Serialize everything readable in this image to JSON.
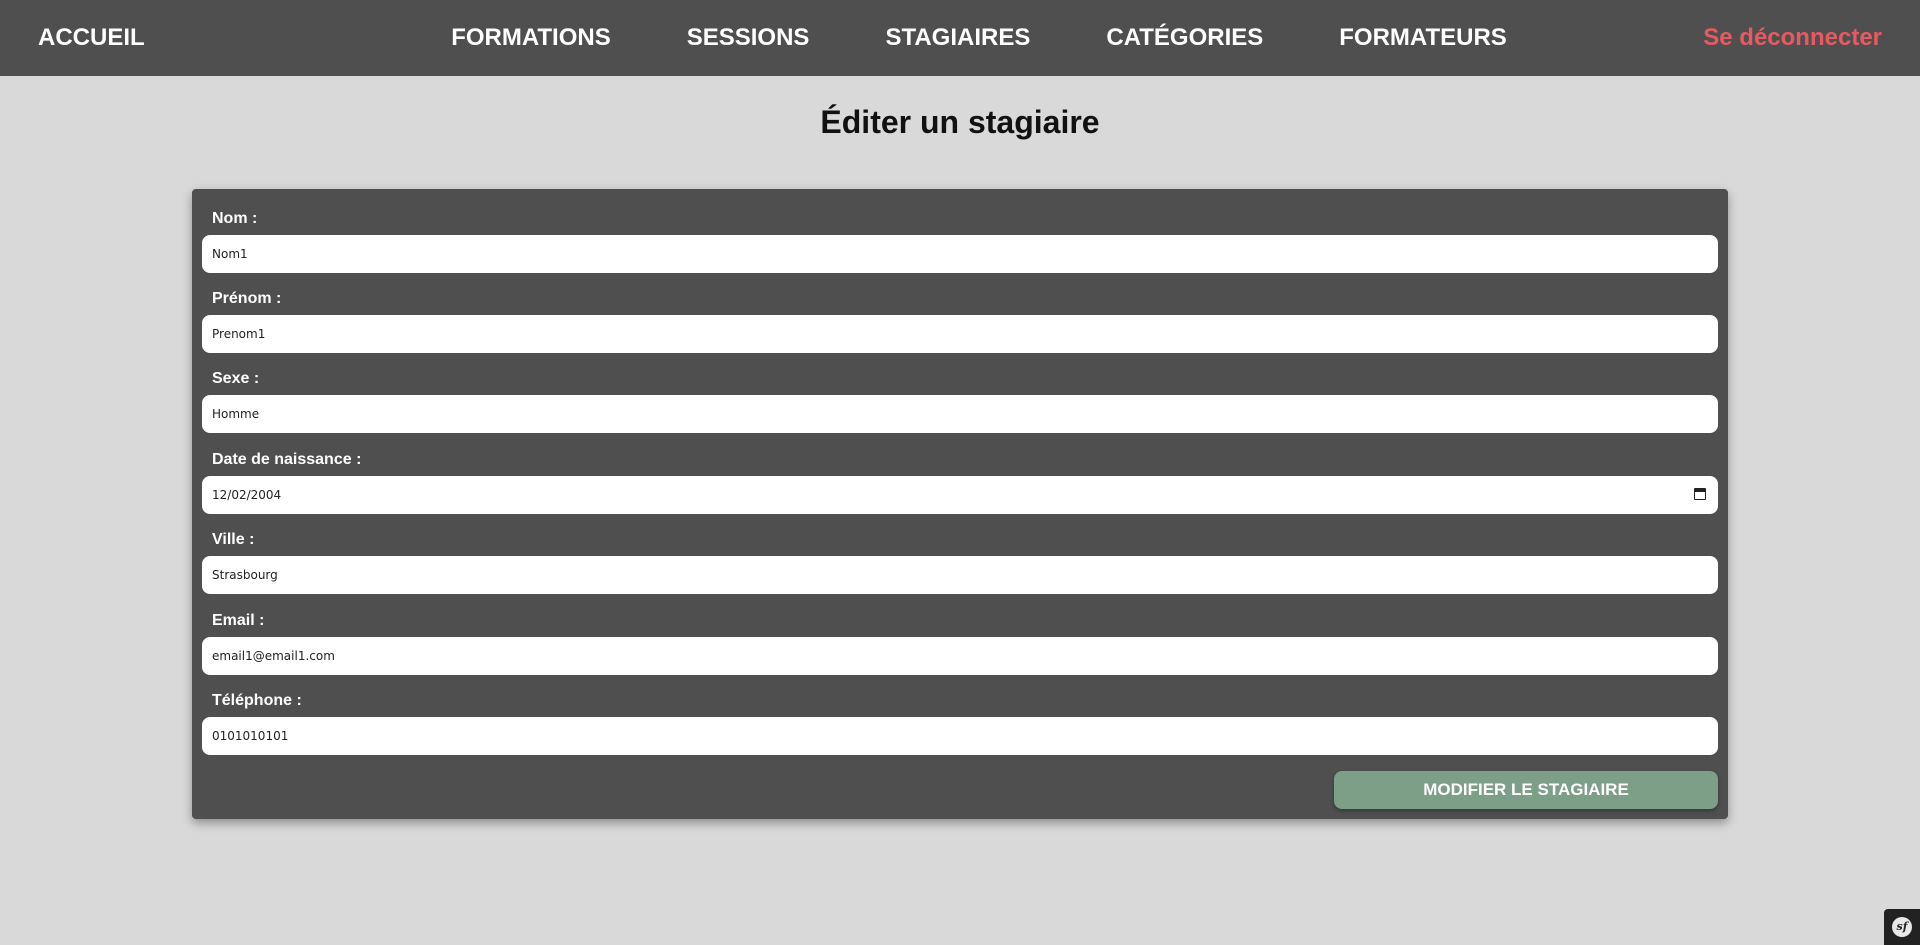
{
  "nav": {
    "home": "ACCUEIL",
    "links": [
      "FORMATIONS",
      "SESSIONS",
      "STAGIAIRES",
      "CATÉGORIES",
      "FORMATEURS"
    ],
    "logout": "Se déconnecter",
    "logout_color": "#e85a62",
    "background": "#4f4f4f"
  },
  "page": {
    "title": "Éditer un stagiaire"
  },
  "form": {
    "fields": [
      {
        "label": "Nom :",
        "value": "Nom1"
      },
      {
        "label": "Prénom :",
        "value": "Prenom1"
      },
      {
        "label": "Sexe :",
        "value": "Homme"
      },
      {
        "label": "Date de naissance :",
        "value": "12/02/2004"
      },
      {
        "label": "Ville :",
        "value": "Strasbourg"
      },
      {
        "label": "Email :",
        "value": "email1@email1.com"
      },
      {
        "label": "Téléphone :",
        "value": "0101010101"
      }
    ],
    "submit_label": "MODIFIER LE STAGIAIRE",
    "submit_color": "#7d9e87"
  },
  "debug_toolbar": {
    "icon": "symfony-logo-icon",
    "logo_text": "sf"
  }
}
